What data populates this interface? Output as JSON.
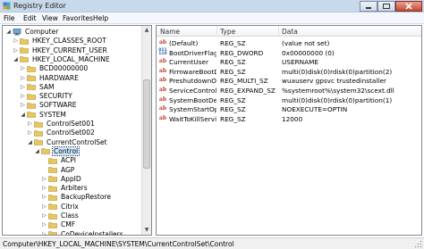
{
  "window": {
    "title": "Registry Editor"
  },
  "menu": [
    "File",
    "Edit",
    "View",
    "Favorites",
    "Help"
  ],
  "tree": [
    {
      "label": "Computer",
      "expander": "◢",
      "icon": "computer"
    },
    {
      "label": "HKEY_CLASSES_ROOT",
      "expander": "▷",
      "icon": "folder"
    },
    {
      "label": "HKEY_CURRENT_USER",
      "expander": "▷",
      "icon": "folder"
    },
    {
      "label": "HKEY_LOCAL_MACHINE",
      "expander": "◢",
      "icon": "folder"
    },
    {
      "label": "BCD00000000",
      "expander": "▷",
      "icon": "folder"
    },
    {
      "label": "HARDWARE",
      "expander": "▷",
      "icon": "folder"
    },
    {
      "label": "SAM",
      "expander": "▷",
      "icon": "folder"
    },
    {
      "label": "SECURITY",
      "expander": "▷",
      "icon": "folder"
    },
    {
      "label": "SOFTWARE",
      "expander": "▷",
      "icon": "folder"
    },
    {
      "label": "SYSTEM",
      "expander": "◢",
      "icon": "folder"
    },
    {
      "label": "ControlSet001",
      "expander": "▷",
      "icon": "folder"
    },
    {
      "label": "ControlSet002",
      "expander": "▷",
      "icon": "folder"
    },
    {
      "label": "CurrentControlSet",
      "expander": "◢",
      "icon": "folder"
    },
    {
      "label": "Control",
      "expander": "◢",
      "icon": "folder-open",
      "selected": true
    },
    {
      "label": "ACPI",
      "expander": "",
      "icon": "folder"
    },
    {
      "label": "AGP",
      "expander": "",
      "icon": "folder"
    },
    {
      "label": "AppID",
      "expander": "▷",
      "icon": "folder"
    },
    {
      "label": "Arbiters",
      "expander": "▷",
      "icon": "folder"
    },
    {
      "label": "BackupRestore",
      "expander": "▷",
      "icon": "folder"
    },
    {
      "label": "Citrix",
      "expander": "▷",
      "icon": "folder"
    },
    {
      "label": "Class",
      "expander": "▷",
      "icon": "folder"
    },
    {
      "label": "CMF",
      "expander": "▷",
      "icon": "folder"
    },
    {
      "label": "CoDeviceInstallers",
      "expander": "▷",
      "icon": "folder"
    }
  ],
  "columns": {
    "name": "Name",
    "type": "Type",
    "data": "Data"
  },
  "values": [
    {
      "name": "(Default)",
      "type": "REG_SZ",
      "data": "(value not set)",
      "icon": "string"
    },
    {
      "name": "BootDriverFlags",
      "type": "REG_DWORD",
      "data": "0x00000000 (0)",
      "icon": "binary"
    },
    {
      "name": "CurrentUser",
      "type": "REG_SZ",
      "data": "USERNAME",
      "icon": "string"
    },
    {
      "name": "FirmwareBootD...",
      "type": "REG_SZ",
      "data": "multi(0)disk(0)rdisk(0)partition(2)",
      "icon": "string"
    },
    {
      "name": "PreshutdownOr...",
      "type": "REG_MULTI_SZ",
      "data": "wuauserv gpsvc trustedinstaller",
      "icon": "string"
    },
    {
      "name": "ServiceControl...",
      "type": "REG_EXPAND_SZ",
      "data": "%systemroot%\\system32\\scext.dll",
      "icon": "string"
    },
    {
      "name": "SystemBootDevi...",
      "type": "REG_SZ",
      "data": "multi(0)disk(0)rdisk(0)partition(1)",
      "icon": "string"
    },
    {
      "name": "SystemStartOpti...",
      "type": "REG_SZ",
      "data": " NOEXECUTE=OPTIN",
      "icon": "string"
    },
    {
      "name": "WaitToKillServic...",
      "type": "REG_SZ",
      "data": "12000",
      "icon": "string"
    }
  ],
  "status": "Computer\\HKEY_LOCAL_MACHINE\\SYSTEM\\CurrentControlSet\\Control",
  "colors": {
    "titlebar": "#c8d9ec",
    "folder": "#e8c660",
    "selection": "#cde8ff"
  }
}
